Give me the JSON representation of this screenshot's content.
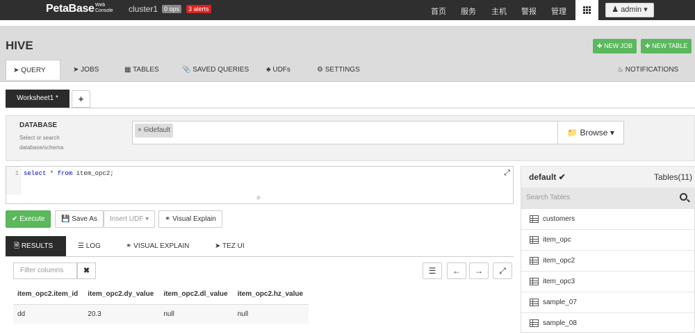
{
  "topbar": {
    "brand": "PetaBase",
    "brand_sub_1": "Web",
    "brand_sub_2": "Console",
    "cluster": "cluster1",
    "ops_badge": "0 ops",
    "alerts_badge": "3 alerts",
    "nav": [
      "首页",
      "服务",
      "主机",
      "警报",
      "管理"
    ],
    "user": "admin"
  },
  "header": {
    "title": "HIVE",
    "new_job": "NEW JOB",
    "new_table": "NEW TABLE",
    "tabs": [
      "QUERY",
      "JOBS",
      "TABLES",
      "SAVED QUERIES",
      "UDFs",
      "SETTINGS"
    ],
    "notifications": "NOTIFICATIONS"
  },
  "worksheet": {
    "tab": "Worksheet1 *",
    "add": "+"
  },
  "database": {
    "label": "DATABASE",
    "help": "Select or search database/schema",
    "chip_remove": "×",
    "selected": "default",
    "browse": "Browse"
  },
  "editor": {
    "line": "1",
    "kw1": "select",
    "t1": " * ",
    "kw2": "from",
    "t2": " item_opc2;"
  },
  "actions": {
    "execute": "Execute",
    "save_as": "Save As",
    "insert_udf": "Insert UDF",
    "visual_explain": "Visual Explain"
  },
  "result_tabs": [
    "RESULTS",
    "LOG",
    "VISUAL EXPLAIN",
    "TEZ UI"
  ],
  "results": {
    "filter_placeholder": "Filter columns",
    "columns": [
      "item_opc2.item_id",
      "item_opc2.dy_value",
      "item_opc2.dl_value",
      "item_opc2.hz_value"
    ],
    "rows": [
      [
        "dd",
        "20.3",
        "null",
        "null"
      ]
    ]
  },
  "sidebar": {
    "db": "default",
    "tables_label": "Tables(11)",
    "search_placeholder": "Search Tables",
    "tables": [
      "customers",
      "item_opc",
      "item_opc2",
      "item_opc3",
      "sample_07",
      "sample_08"
    ]
  },
  "colors": {
    "topbar": "#2f2f2f",
    "green": "#5cb85c",
    "alert_red": "#d9231f"
  }
}
